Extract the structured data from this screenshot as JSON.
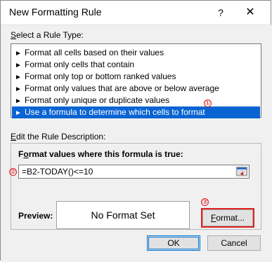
{
  "window": {
    "title": "New Formatting Rule",
    "help_glyph": "?",
    "close_glyph": "✕"
  },
  "rule_type": {
    "label_mnemonic": "S",
    "label_rest": "elect a Rule Type:",
    "items": [
      {
        "label": "Format all cells based on their values",
        "selected": false
      },
      {
        "label": "Format only cells that contain",
        "selected": false
      },
      {
        "label": "Format only top or bottom ranked values",
        "selected": false
      },
      {
        "label": "Format only values that are above or below average",
        "selected": false
      },
      {
        "label": "Format only unique or duplicate values",
        "selected": false
      },
      {
        "label": "Use a formula to determine which cells to format",
        "selected": true
      }
    ],
    "arrow_glyph": "►"
  },
  "description": {
    "label_mnemonic": "E",
    "label_rest": "dit the Rule Description:",
    "formula_heading_pre": "F",
    "formula_heading_mnemonic": "o",
    "formula_heading_rest": "rmat values where this formula is true:",
    "formula_value": "=B2-TODAY()<=10",
    "preview_label": "Preview:",
    "preview_text": "No Format Set",
    "format_button_mnemonic": "F",
    "format_button_rest": "ormat..."
  },
  "footer": {
    "ok_label": "OK",
    "cancel_label": "Cancel"
  },
  "annotations": {
    "one": "①",
    "two": "②",
    "three": "③"
  },
  "colors": {
    "selection": "#0a64d2",
    "annotation_red": "#e02020",
    "ok_border": "#0078d7"
  },
  "icons": {
    "help": "question-mark-icon",
    "close": "close-icon",
    "list_arrow": "triangle-right-icon",
    "range_picker": "collapse-dialog-icon"
  }
}
